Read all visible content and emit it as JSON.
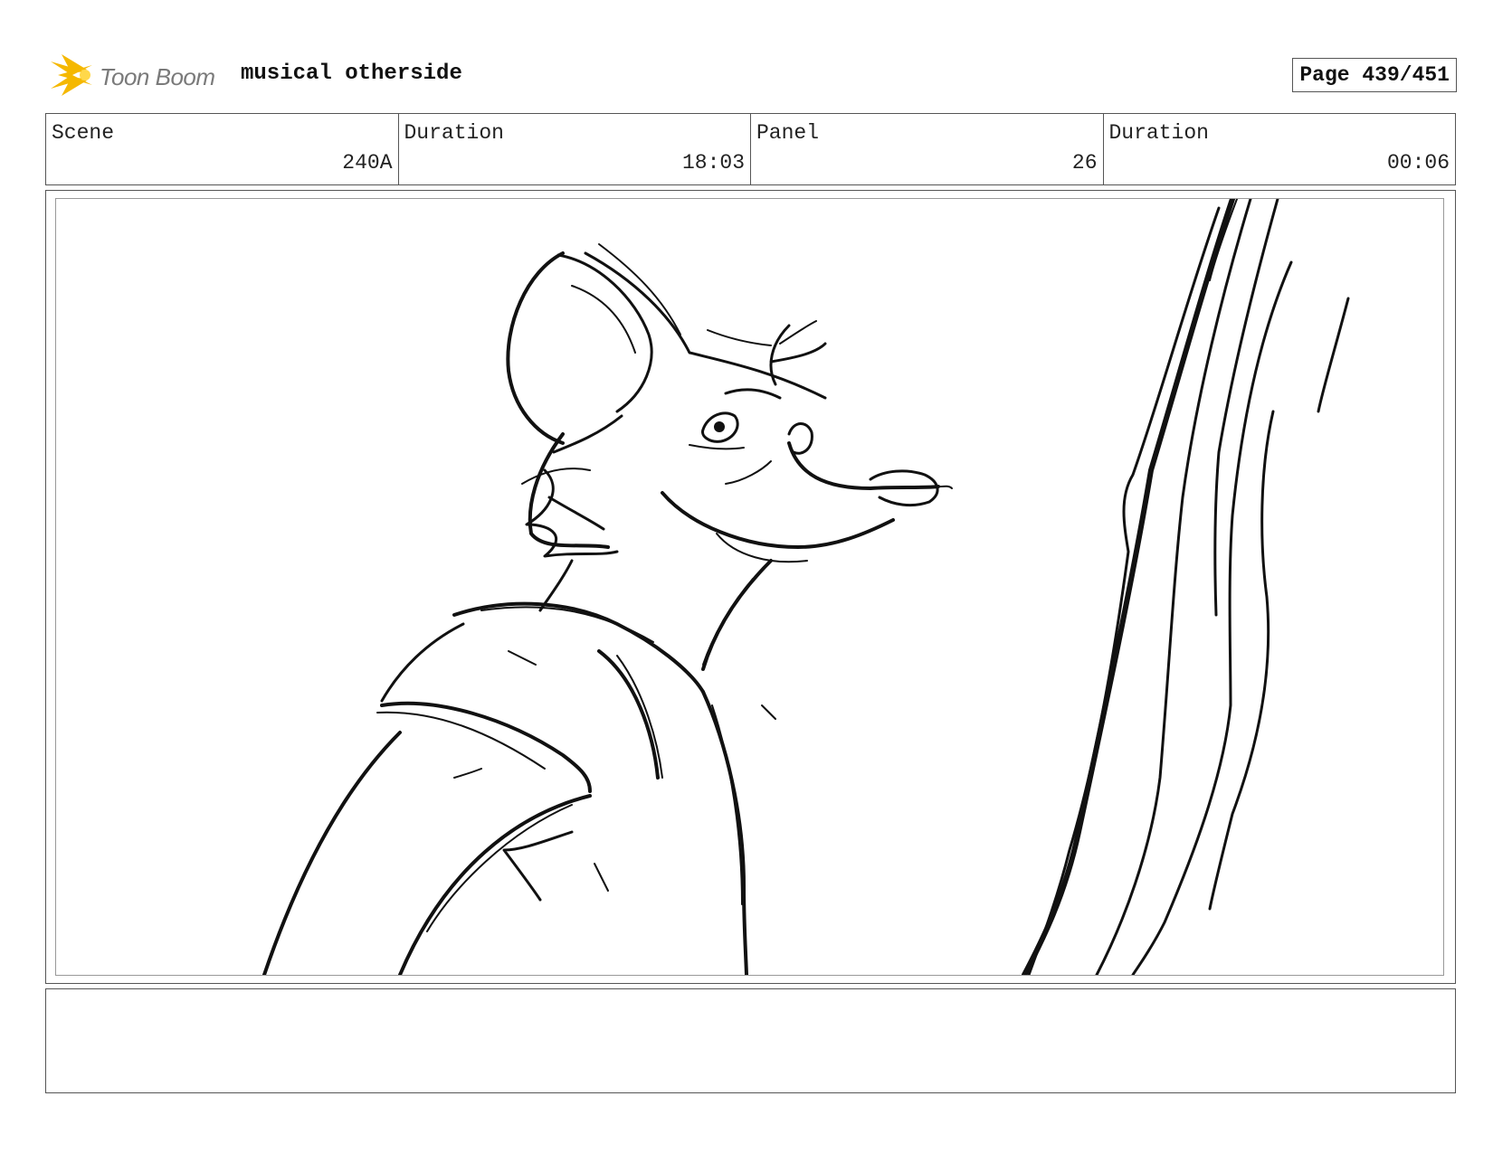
{
  "header": {
    "logo_text": "Toon Boom",
    "project_title": "musical otherside",
    "page_label": "Page 439/451"
  },
  "info": [
    {
      "label": "Scene",
      "value": "240A"
    },
    {
      "label": "Duration",
      "value": "18:03"
    },
    {
      "label": "Panel",
      "value": "26"
    },
    {
      "label": "Duration",
      "value": "00:06"
    }
  ],
  "panel": {
    "drawing": "sketch-of-rat-character-looking-up-with-tree-trunk"
  },
  "notes": {
    "text": ""
  },
  "colors": {
    "logo_accent": "#f5b800",
    "border": "#555555",
    "ink": "#111111"
  }
}
